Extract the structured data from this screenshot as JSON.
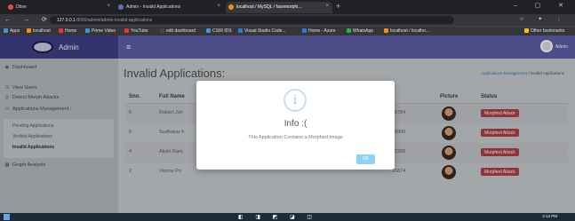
{
  "browser": {
    "tabs": [
      {
        "title": "Dbse",
        "color": "#e4523b"
      },
      {
        "title": "Admin - Invalid Applications",
        "color": "#6a6ab8"
      },
      {
        "title": "localhost / MySQL / facemorphi...",
        "color": "#f29111"
      }
    ],
    "url_host": "127.0.0.1",
    "url_path": ":8000/admin/admin-invalid-applications",
    "bookmarks": [
      {
        "label": "Apps",
        "color": "#4a8fd8"
      },
      {
        "label": "localhost",
        "color": "#f29111"
      },
      {
        "label": "Home",
        "color": "#e33"
      },
      {
        "label": "Prime Video",
        "color": "#2e9bd8"
      },
      {
        "label": "YouTube",
        "color": "#e33"
      },
      {
        "label": "edit dashboard",
        "color": "#444"
      },
      {
        "label": "CSIR IDS",
        "color": "#4a8fd8"
      },
      {
        "label": "Visual Studio Code...",
        "color": "#2e7bd8"
      },
      {
        "label": "Home - Azure",
        "color": "#2e7bd8"
      },
      {
        "label": "WhatsApp",
        "color": "#28b24b"
      },
      {
        "label": "localhost / localho...",
        "color": "#f29111"
      },
      {
        "label": "Other bookmarks",
        "color": "#f2c511"
      }
    ]
  },
  "app": {
    "brand": "Admin",
    "user": "Admin",
    "sidebar": {
      "items": [
        {
          "label": "Dashboard",
          "icon": "dashboard-icon"
        },
        {
          "label": "View Users",
          "icon": "users-icon"
        },
        {
          "label": "Detect Morph Attacks",
          "icon": "eye-icon"
        },
        {
          "label": "Applications Management",
          "icon": "clipboard-icon"
        },
        {
          "label": "Graph Analysis",
          "icon": "chart-icon"
        }
      ],
      "sub_items": [
        "Pending Applications",
        "Verified Applications",
        "Invalid Applications"
      ]
    },
    "page_title": "Invalid Applications:",
    "breadcrumb": {
      "parent": "Applications Management",
      "sep": "/",
      "current": "Invalid Applications"
    },
    "table": {
      "headers": [
        "Sno.",
        "Full Name",
        "Picture",
        "Status"
      ],
      "rows": [
        {
          "sno": "6",
          "name": "Robert Joh",
          "tail": "45784",
          "status": "Morphed Attack"
        },
        {
          "sno": "6",
          "name": "Sudhakar K",
          "tail": "38900",
          "status": "Morphed Attack"
        },
        {
          "sno": "4",
          "name": "Akshi Ram",
          "tail": "42365",
          "status": "Morphed Attack"
        },
        {
          "sno": "2",
          "name": "Vishnu Pri",
          "tail": "15874",
          "status": "Morphed Attack"
        }
      ]
    }
  },
  "modal": {
    "icon": "i",
    "title": "Info :(",
    "text": "This Application Contains a Morphed Image",
    "ok": "OK"
  },
  "taskbar": {
    "time": "2:14 PM"
  }
}
